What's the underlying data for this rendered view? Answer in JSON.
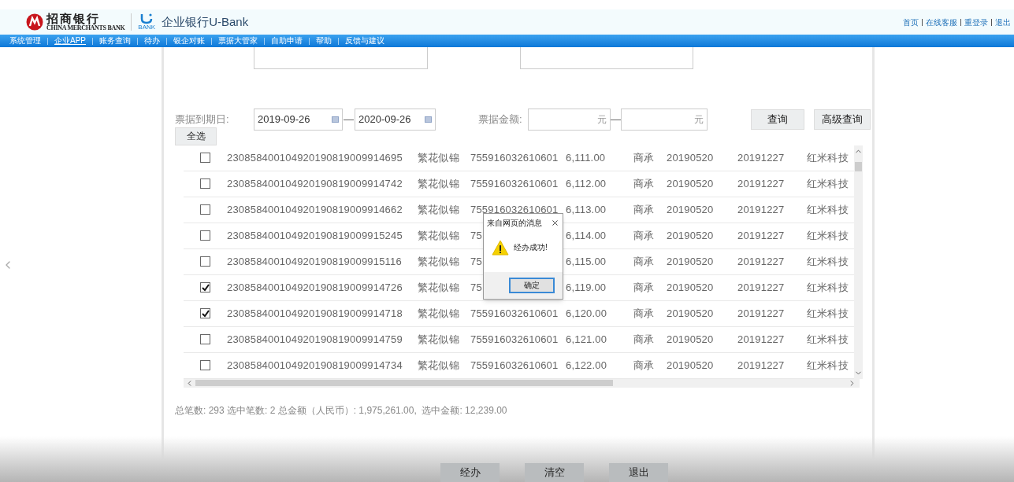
{
  "header": {
    "logo_text": "招商银行",
    "logo_subtext": "CHINA MERCHANTS BANK",
    "ubank_subtext": "BANK",
    "title": "企业银行U-Bank",
    "links": [
      "首页",
      "在线客服",
      "重登录",
      "退出"
    ]
  },
  "nav": [
    {
      "label": "系统管理",
      "selected": false
    },
    {
      "label": "企业APP",
      "selected": true
    },
    {
      "label": "账务查询",
      "selected": false
    },
    {
      "label": "待办",
      "selected": false
    },
    {
      "label": "银企对账",
      "selected": false
    },
    {
      "label": "票据大管家",
      "selected": false
    },
    {
      "label": "自助申请",
      "selected": false
    },
    {
      "label": "帮助",
      "selected": false
    },
    {
      "label": "反馈与建议",
      "selected": false
    }
  ],
  "filters": {
    "due_date_label": "票据到期日:",
    "date_from": "2019-09-26",
    "date_to": "2020-09-26",
    "range_separator": "—",
    "amount_label": "票据金额:",
    "amount_from_unit": "元",
    "amount_to_unit": "元",
    "buttons": [
      "查询",
      "高级查询"
    ]
  },
  "select_all_button": "全选",
  "rows": [
    {
      "checked": false,
      "cells": [
        "230858400104920190819009914695",
        "繁花似锦",
        "755916032610601",
        "6,111.00",
        "商承",
        "20190520",
        "20191227",
        "红米科技"
      ]
    },
    {
      "checked": false,
      "cells": [
        "230858400104920190819009914742",
        "繁花似锦",
        "755916032610601",
        "6,112.00",
        "商承",
        "20190520",
        "20191227",
        "红米科技"
      ]
    },
    {
      "checked": false,
      "cells": [
        "230858400104920190819009914662",
        "繁花似锦",
        "755916032610601",
        "6,113.00",
        "商承",
        "20190520",
        "20191227",
        "红米科技"
      ]
    },
    {
      "checked": false,
      "cells": [
        "230858400104920190819009915245",
        "繁花似锦",
        "75",
        "6,114.00",
        "商承",
        "20190520",
        "20191227",
        "红米科技"
      ]
    },
    {
      "checked": false,
      "cells": [
        "230858400104920190819009915116",
        "繁花似锦",
        "75",
        "6,115.00",
        "商承",
        "20190520",
        "20191227",
        "红米科技"
      ]
    },
    {
      "checked": true,
      "cells": [
        "230858400104920190819009914726",
        "繁花似锦",
        "75",
        "6,119.00",
        "商承",
        "20190520",
        "20191227",
        "红米科技"
      ]
    },
    {
      "checked": true,
      "cells": [
        "230858400104920190819009914718",
        "繁花似锦",
        "755916032610601",
        "6,120.00",
        "商承",
        "20190520",
        "20191227",
        "红米科技"
      ]
    },
    {
      "checked": false,
      "cells": [
        "230858400104920190819009914759",
        "繁花似锦",
        "755916032610601",
        "6,121.00",
        "商承",
        "20190520",
        "20191227",
        "红米科技"
      ]
    },
    {
      "checked": false,
      "cells": [
        "230858400104920190819009914734",
        "繁花似锦",
        "755916032610601",
        "6,122.00",
        "商承",
        "20190520",
        "20191227",
        "红米科技"
      ]
    }
  ],
  "summary": "总笔数: 293 选中笔数: 2 总金额（人民币）: 1,975,261.00,  选中金额: 12,239.00",
  "dialog": {
    "title": "来自网页的消息",
    "message": "经办成功!",
    "ok_button": "确定"
  },
  "footer_buttons": [
    "经办",
    "清空",
    "退出"
  ]
}
